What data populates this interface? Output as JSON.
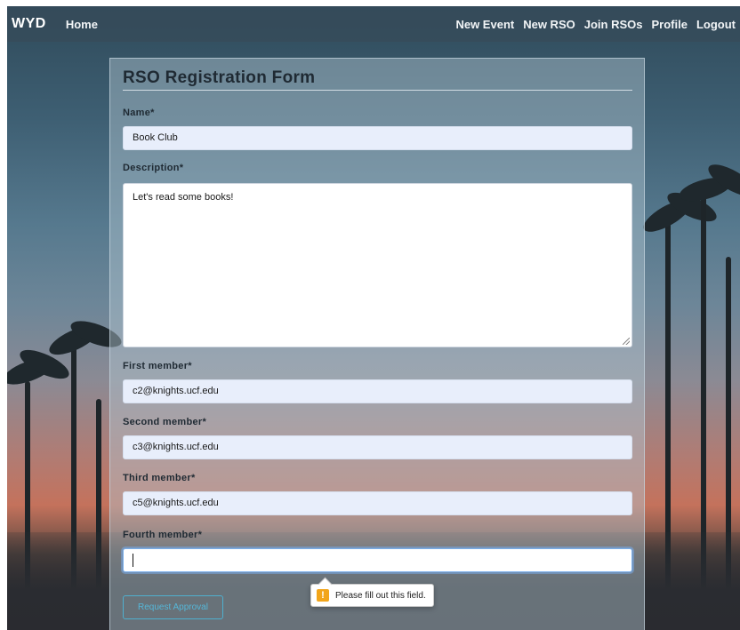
{
  "nav": {
    "brand": "WYD",
    "home": "Home",
    "links": [
      "New Event",
      "New RSO",
      "Join RSOs",
      "Profile",
      "Logout"
    ]
  },
  "form": {
    "title": "RSO Registration Form",
    "name": {
      "label": "Name*",
      "value": "Book Club"
    },
    "description": {
      "label": "Description*",
      "value": "Let's read some books!"
    },
    "first_member": {
      "label": "First member*",
      "value": "c2@knights.ucf.edu"
    },
    "second_member": {
      "label": "Second member*",
      "value": "c3@knights.ucf.edu"
    },
    "third_member": {
      "label": "Third member*",
      "value": "c5@knights.ucf.edu"
    },
    "fourth_member": {
      "label": "Fourth member*",
      "value": ""
    },
    "submit_label": "Request Approval"
  },
  "validation": {
    "message": "Please fill out this field.",
    "icon": "warning-icon",
    "icon_glyph": "!"
  },
  "colors": {
    "accent": "#55b7d8",
    "warning": "#f2a51a"
  }
}
